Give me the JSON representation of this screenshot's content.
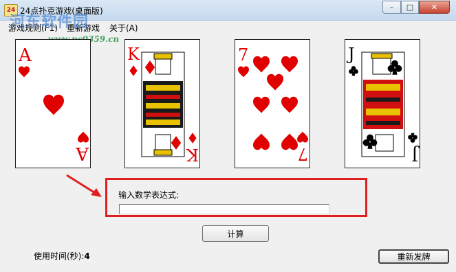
{
  "window": {
    "title": "24点扑克游戏(桌面版)",
    "minimize_glyph": "–",
    "maximize_glyph": "□",
    "close_glyph": "✕"
  },
  "menu": {
    "items": [
      {
        "label": "游戏规则(F1)"
      },
      {
        "label": "重新游戏"
      },
      {
        "label": "关于(A)"
      }
    ]
  },
  "watermark": {
    "text": "河东软件园",
    "url": "www.pc0359.cn"
  },
  "cards": [
    {
      "rank": "A",
      "suit": "hearts",
      "color": "#e00000"
    },
    {
      "rank": "K",
      "suit": "diamonds",
      "color": "#e00000"
    },
    {
      "rank": "7",
      "suit": "hearts",
      "color": "#e00000"
    },
    {
      "rank": "J",
      "suit": "clubs",
      "color": "#000000"
    }
  ],
  "expression": {
    "label": "输入数学表达式:",
    "value": ""
  },
  "buttons": {
    "calculate": "计算",
    "redeal": "重新发牌"
  },
  "timer": {
    "label": "使用时间(秒):",
    "value": "4"
  },
  "colors": {
    "highlight": "#e02020",
    "card_red": "#e00000"
  }
}
